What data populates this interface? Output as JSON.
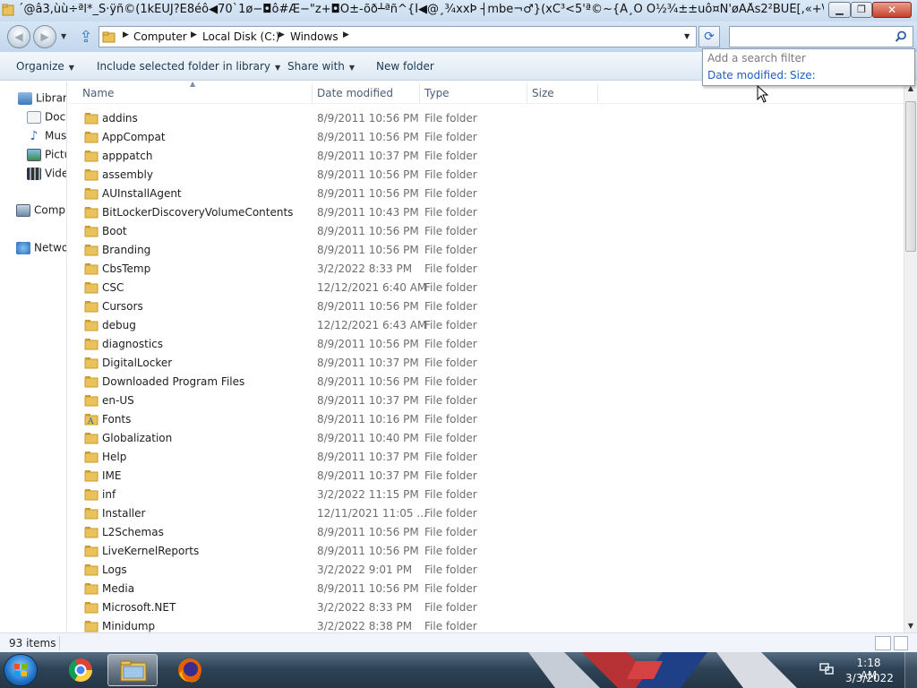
{
  "window": {
    "title": "´@â3,ùù÷ªl*_S·ÿñ©(1kËUJ?Ë8éô◀70`1ø−◘ô#Æ−\"z+◘Ö±-õð┴ªñ^{Î◀@¸¾xxÞ ┤mbe¬♂}(xC³<5'ª©~{Â¸Õ Ò½¾±±uô¤Ñ'øÃÅs2²BÚÊ[,«+\\`−[ï8..."
  },
  "address": {
    "breadcrumbs": [
      "Computer",
      "Local Disk (C:)",
      "Windows"
    ],
    "search_placeholder": ""
  },
  "toolbar": {
    "organize": "Organize",
    "include": "Include selected folder in library",
    "share": "Share with",
    "new_folder": "New folder"
  },
  "filter": {
    "hint": "Add a search filter",
    "date_modified": "Date modified:",
    "size": "Size:"
  },
  "nav": {
    "libraries": "Librari",
    "documents": "Doc",
    "music": "Mus",
    "pictures": "Pictu",
    "videos": "Vide",
    "computer": "Comp",
    "network": "Netwo"
  },
  "columns": {
    "name": "Name",
    "date": "Date modified",
    "type": "Type",
    "size": "Size"
  },
  "files": [
    {
      "name": "addins",
      "date": "8/9/2011 10:56 PM",
      "type": "File folder",
      "icon": "folder-icon"
    },
    {
      "name": "AppCompat",
      "date": "8/9/2011 10:56 PM",
      "type": "File folder",
      "icon": "folder-icon"
    },
    {
      "name": "apppatch",
      "date": "8/9/2011 10:37 PM",
      "type": "File folder",
      "icon": "folder-icon"
    },
    {
      "name": "assembly",
      "date": "8/9/2011 10:56 PM",
      "type": "File folder",
      "icon": "folder-icon"
    },
    {
      "name": "AUInstallAgent",
      "date": "8/9/2011 10:56 PM",
      "type": "File folder",
      "icon": "folder-icon"
    },
    {
      "name": "BitLockerDiscoveryVolumeContents",
      "date": "8/9/2011 10:43 PM",
      "type": "File folder",
      "icon": "folder-icon"
    },
    {
      "name": "Boot",
      "date": "8/9/2011 10:56 PM",
      "type": "File folder",
      "icon": "folder-icon"
    },
    {
      "name": "Branding",
      "date": "8/9/2011 10:56 PM",
      "type": "File folder",
      "icon": "folder-icon"
    },
    {
      "name": "CbsTemp",
      "date": "3/2/2022 8:33 PM",
      "type": "File folder",
      "icon": "folder-icon"
    },
    {
      "name": "CSC",
      "date": "12/12/2021 6:40 AM",
      "type": "File folder",
      "icon": "folder-icon"
    },
    {
      "name": "Cursors",
      "date": "8/9/2011 10:56 PM",
      "type": "File folder",
      "icon": "folder-icon"
    },
    {
      "name": "debug",
      "date": "12/12/2021 6:43 AM",
      "type": "File folder",
      "icon": "folder-icon"
    },
    {
      "name": "diagnostics",
      "date": "8/9/2011 10:56 PM",
      "type": "File folder",
      "icon": "folder-icon"
    },
    {
      "name": "DigitalLocker",
      "date": "8/9/2011 10:37 PM",
      "type": "File folder",
      "icon": "folder-icon"
    },
    {
      "name": "Downloaded Program Files",
      "date": "8/9/2011 10:56 PM",
      "type": "File folder",
      "icon": "folder-icon"
    },
    {
      "name": "en-US",
      "date": "8/9/2011 10:37 PM",
      "type": "File folder",
      "icon": "folder-icon"
    },
    {
      "name": "Fonts",
      "date": "8/9/2011 10:16 PM",
      "type": "File folder",
      "icon": "fonts-folder-icon"
    },
    {
      "name": "Globalization",
      "date": "8/9/2011 10:40 PM",
      "type": "File folder",
      "icon": "folder-icon"
    },
    {
      "name": "Help",
      "date": "8/9/2011 10:37 PM",
      "type": "File folder",
      "icon": "folder-icon"
    },
    {
      "name": "IME",
      "date": "8/9/2011 10:37 PM",
      "type": "File folder",
      "icon": "folder-icon"
    },
    {
      "name": "inf",
      "date": "3/2/2022 11:15 PM",
      "type": "File folder",
      "icon": "folder-icon"
    },
    {
      "name": "Installer",
      "date": "12/11/2021 11:05 ...",
      "type": "File folder",
      "icon": "folder-icon"
    },
    {
      "name": "L2Schemas",
      "date": "8/9/2011 10:56 PM",
      "type": "File folder",
      "icon": "folder-icon"
    },
    {
      "name": "LiveKernelReports",
      "date": "8/9/2011 10:56 PM",
      "type": "File folder",
      "icon": "folder-icon"
    },
    {
      "name": "Logs",
      "date": "3/2/2022 9:01 PM",
      "type": "File folder",
      "icon": "folder-icon"
    },
    {
      "name": "Media",
      "date": "8/9/2011 10:56 PM",
      "type": "File folder",
      "icon": "folder-icon"
    },
    {
      "name": "Microsoft.NET",
      "date": "3/2/2022 8:33 PM",
      "type": "File folder",
      "icon": "folder-icon"
    },
    {
      "name": "Minidump",
      "date": "3/2/2022 8:38 PM",
      "type": "File folder",
      "icon": "folder-icon"
    }
  ],
  "status": {
    "count": "93 items"
  },
  "taskbar": {
    "apps": [
      "start-icon",
      "chrome-icon",
      "explorer-icon",
      "firefox-icon"
    ],
    "time": "1:18 AM",
    "date": "3/3/2022"
  },
  "colors": {
    "folder": "#e9c25b",
    "folder_dark": "#c99a2e",
    "link": "#1f5fbf",
    "header_text": "#4c607a",
    "taskbar": "#2e4356"
  }
}
